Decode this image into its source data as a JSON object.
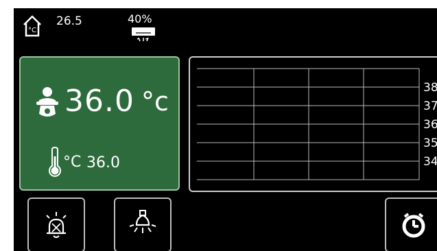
{
  "status": {
    "room_temperature": "26.5",
    "ac_level": "40%",
    "room_icon": "house-thermometer-icon",
    "ac_icon": "air-conditioner-icon"
  },
  "baby_panel": {
    "icon": "baby-icon",
    "baby_temperature": "36.0",
    "baby_unit": "°c",
    "probe_icon": "thermometer-icon",
    "probe_unit": "°C",
    "probe_temperature": "36.0",
    "background_color": "#2d6b3c"
  },
  "chart_data": {
    "type": "line",
    "title": "",
    "xlabel": "",
    "ylabel": "",
    "y_tick_labels": [
      "38",
      "37",
      "36",
      "35",
      "34"
    ],
    "ylim": [
      33,
      39
    ],
    "grid": true,
    "series": []
  },
  "buttons": {
    "alarm_icon": "alarm-bell-icon",
    "light_icon": "light-bulb-icon",
    "timer_icon": "timer-icon"
  }
}
